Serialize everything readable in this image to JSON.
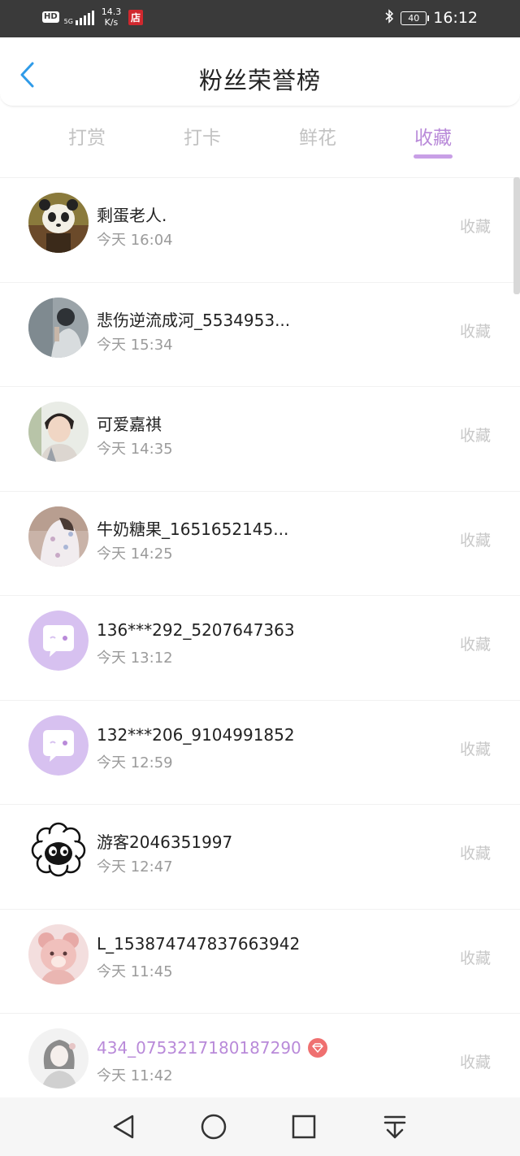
{
  "status_bar": {
    "hd": "HD",
    "network": "5G",
    "speed_value": "14.3",
    "speed_unit": "K/s",
    "shop_badge": "店",
    "battery": "40",
    "time": "16:12"
  },
  "header": {
    "title": "粉丝荣誉榜"
  },
  "tabs": [
    {
      "label": "打赏",
      "active": false
    },
    {
      "label": "打卡",
      "active": false
    },
    {
      "label": "鲜花",
      "active": false
    },
    {
      "label": "收藏",
      "active": true
    }
  ],
  "list": [
    {
      "name": "剩蛋老人.",
      "time": "今天 16:04",
      "action": "收藏",
      "avatar": "panda-avatar"
    },
    {
      "name": "悲伤逆流成河_5534953...",
      "time": "今天 15:34",
      "action": "收藏",
      "avatar": "person-avatar"
    },
    {
      "name": "可爱嘉祺",
      "time": "今天 14:35",
      "action": "收藏",
      "avatar": "boy-avatar"
    },
    {
      "name": "牛奶糖果_1651652145...",
      "time": "今天 14:25",
      "action": "收藏",
      "avatar": "girl-avatar"
    },
    {
      "name": "136***292_5207647363",
      "time": "今天 13:12",
      "action": "收藏",
      "avatar": "default-chat-avatar"
    },
    {
      "name": "132***206_9104991852",
      "time": "今天 12:59",
      "action": "收藏",
      "avatar": "default-chat-avatar"
    },
    {
      "name": "游客2046351997",
      "time": "今天 12:47",
      "action": "收藏",
      "avatar": "sheep-avatar"
    },
    {
      "name": "L_153874747837663942",
      "time": "今天 11:45",
      "action": "收藏",
      "avatar": "bear-avatar"
    },
    {
      "name": "434_0753217180187290",
      "time": "今天 11:42",
      "action": "收藏",
      "avatar": "sketch-girl-avatar",
      "vip": true
    }
  ],
  "colors": {
    "accent": "#b98ad9",
    "gem": "#ef7070",
    "back_arrow": "#2f9be8"
  }
}
